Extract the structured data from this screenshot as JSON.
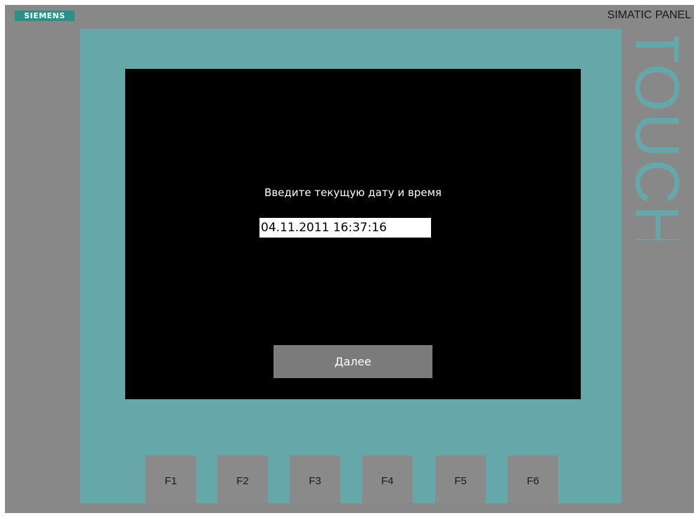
{
  "panel": {
    "brand": "SIEMENS",
    "model": "SIMATIC PANEL",
    "touch_label": "TOUCH"
  },
  "screen": {
    "prompt": "Введите текущую дату и время",
    "datetime_value": "04.11.2011 16:37:16",
    "next_label": "Далее"
  },
  "function_keys": [
    "F1",
    "F2",
    "F3",
    "F4",
    "F5",
    "F6"
  ],
  "colors": {
    "bezel": "#66a7a9",
    "housing": "#888888",
    "screen": "#000000",
    "brand_badge": "#2f8f86"
  }
}
